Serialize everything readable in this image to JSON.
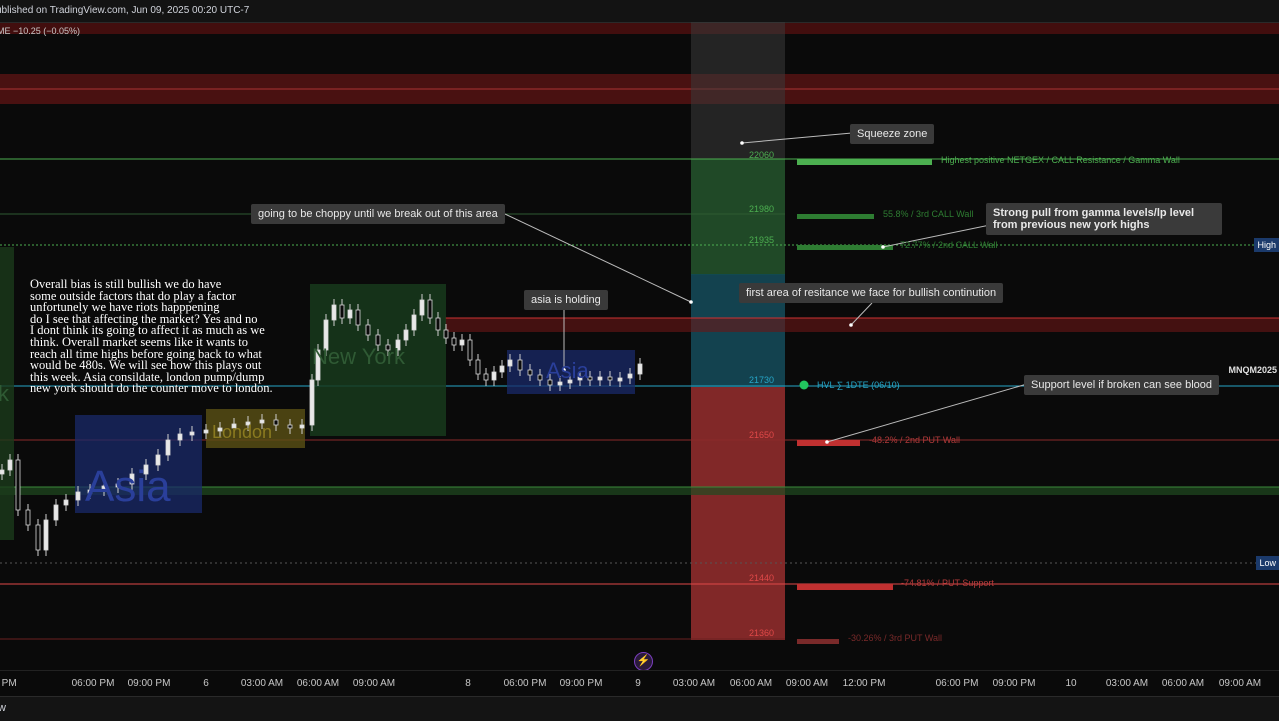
{
  "header": {
    "published": "ublished on TradingView.com, Jun 09, 2025 00:20 UTC-7",
    "ticker_change": "ME  −10.25 (−0.05%)"
  },
  "price_levels": [
    {
      "price": "22060",
      "color": "#4caf50"
    },
    {
      "price": "21980",
      "color": "#4caf50"
    },
    {
      "price": "21935",
      "color": "#4caf50"
    },
    {
      "price": "21730",
      "color": "#26a6c8"
    },
    {
      "price": "21650",
      "color": "#e04848"
    },
    {
      "price": "21440",
      "color": "#e04848"
    },
    {
      "price": "21360",
      "color": "#e04848"
    }
  ],
  "gex_labels": [
    {
      "text": "Highest positive NETGEX / CALL Resistance / Gamma Wall",
      "color": "#4caf50"
    },
    {
      "text": "55.8% / 3rd CALL Wall",
      "color": "#2e7d32"
    },
    {
      "text": "72.77% / 2nd CALL Wall",
      "color": "#2e7d32"
    },
    {
      "text": "HVL ∑ 1DTE (06/10)",
      "color": "#26a6c8"
    },
    {
      "text": "-48.2% / 2nd PUT Wall",
      "color": "#b23a3a"
    },
    {
      "text": "-74.81% / PUT Support",
      "color": "#b23a3a"
    },
    {
      "text": "-30.26% / 3rd PUT Wall",
      "color": "#7a2a2a"
    }
  ],
  "annotations": {
    "squeeze": "Squeeze zone",
    "choppy": "going to be choppy until we break out of this area",
    "strong_pull": "Strong pull from gamma levels/lp level from previous new york highs",
    "first_resistance": "first area of resitance we face for bullish continution",
    "asia_holding": "asia is holding",
    "support": "Support level if broken can see blood",
    "bias": "Overall bias is still bullish we do have\nsome outside factors that do play a factor\nunfortunely we have riots happpening\ndo I see that affecting the market? Yes and no\nI dont think its going to affect it as much as we\nthink. Overall market seems like it wants to\nreach all time highs before going back to what\nwould be 480s. We will see how this plays out\nthis week. Asia consildate, london pump/dump\nnew york should do the counter move to london."
  },
  "sessions": {
    "asia": "Asia",
    "london": "London",
    "new_york": "New York",
    "asia2": "Asia",
    "left_k": "k"
  },
  "right_edge": {
    "high": "High",
    "low": "Low",
    "symbol": "MNQM2025"
  },
  "x_axis": [
    "0 PM",
    "06:00 PM",
    "09:00 PM",
    "6",
    "03:00 AM",
    "06:00 AM",
    "09:00 AM",
    "8",
    "06:00 PM",
    "09:00 PM",
    "9",
    "03:00 AM",
    "06:00 AM",
    "09:00 AM",
    "12:00 PM",
    "06:00 PM",
    "09:00 PM",
    "10",
    "03:00 AM",
    "06:00 AM",
    "09:00 AM"
  ],
  "footer": {
    "text": "w"
  },
  "colors": {
    "bull": "#4caf50",
    "bear": "#e04848",
    "hvl": "#26a6c8",
    "candle": "#d9d9d9"
  }
}
